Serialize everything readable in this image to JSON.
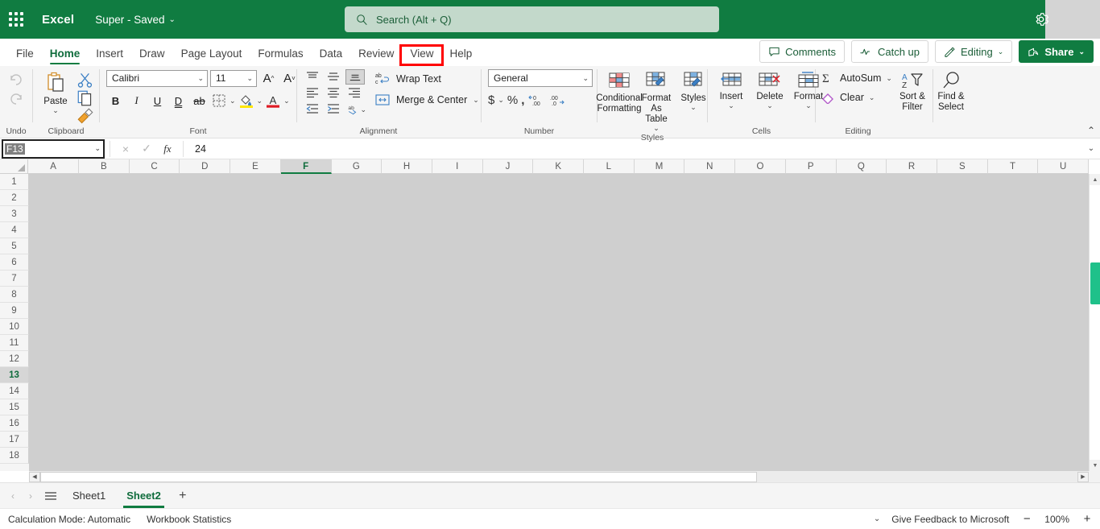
{
  "titlebar": {
    "waffle_name": "app-launcher",
    "app_name": "Excel",
    "doc_name": "Super  -  Saved",
    "doc_chevron": "⌄",
    "search_placeholder": "Search (Alt + Q)",
    "brand_color": "#107c41"
  },
  "tabs": [
    {
      "label": "File",
      "active": false
    },
    {
      "label": "Home",
      "active": true
    },
    {
      "label": "Insert",
      "active": false
    },
    {
      "label": "Draw",
      "active": false
    },
    {
      "label": "Page Layout",
      "active": false
    },
    {
      "label": "Formulas",
      "active": false
    },
    {
      "label": "Data",
      "active": false
    },
    {
      "label": "Review",
      "active": false
    },
    {
      "label": "View",
      "active": false,
      "annotated": true
    },
    {
      "label": "Help",
      "active": false
    }
  ],
  "tab_actions": {
    "comments": "Comments",
    "catch_up": "Catch up",
    "editing": "Editing",
    "share": "Share",
    "chevron": "⌄",
    "annotation_color": "#ff0000"
  },
  "ribbon": {
    "undo_label": "Undo",
    "clipboard_label": "Clipboard",
    "paste_label": "Paste",
    "font_label": "Font",
    "font_name": "Calibri",
    "font_size": "11",
    "alignment_label": "Alignment",
    "wrap_text": "Wrap Text",
    "merge_center": "Merge & Center",
    "number_label": "Number",
    "number_format": "General",
    "styles_label": "Styles",
    "conditional_formatting": "Conditional Formatting",
    "format_as_table": "Format As Table",
    "cell_styles": "Styles",
    "cells_label": "Cells",
    "insert": "Insert",
    "delete": "Delete",
    "format": "Format",
    "editing_label": "Editing",
    "autosum": "AutoSum",
    "clear": "Clear",
    "sort_filter": "Sort & Filter",
    "find_select": "Find & Select",
    "chevron": "⌄",
    "collapse": "⌃"
  },
  "formula_bar": {
    "name_box_value": "F13",
    "name_box_chevron": "⌄",
    "cancel": "×",
    "enter": "✓",
    "fx": "fx",
    "formula_value": "24",
    "expand": "⌄"
  },
  "grid": {
    "columns": [
      "A",
      "B",
      "C",
      "D",
      "E",
      "F",
      "G",
      "H",
      "I",
      "J",
      "K",
      "L",
      "M",
      "N",
      "O",
      "P",
      "Q",
      "R",
      "S",
      "T",
      "U"
    ],
    "selected_column": "F",
    "rows": [
      "1",
      "2",
      "3",
      "4",
      "5",
      "6",
      "7",
      "8",
      "9",
      "10",
      "11",
      "12",
      "13",
      "14",
      "15",
      "16",
      "17",
      "18"
    ],
    "selected_row": "13",
    "scroll_marker_color": "#1fc18a",
    "up_arrow": "▲",
    "down_arrow": "▼",
    "left_arrow": "◀",
    "right_arrow": "▶"
  },
  "sheetbar": {
    "prev": "‹",
    "next": "›",
    "all_sheets": "all-sheets",
    "sheets": [
      {
        "label": "Sheet1",
        "active": false
      },
      {
        "label": "Sheet2",
        "active": true
      }
    ],
    "add": "+"
  },
  "statusbar": {
    "calculation_mode": "Calculation Mode: Automatic",
    "workbook_statistics": "Workbook Statistics",
    "chevron": "⌄",
    "feedback": "Give Feedback to Microsoft",
    "zoom_out": "−",
    "zoom_level": "100%",
    "zoom_in": "+"
  }
}
